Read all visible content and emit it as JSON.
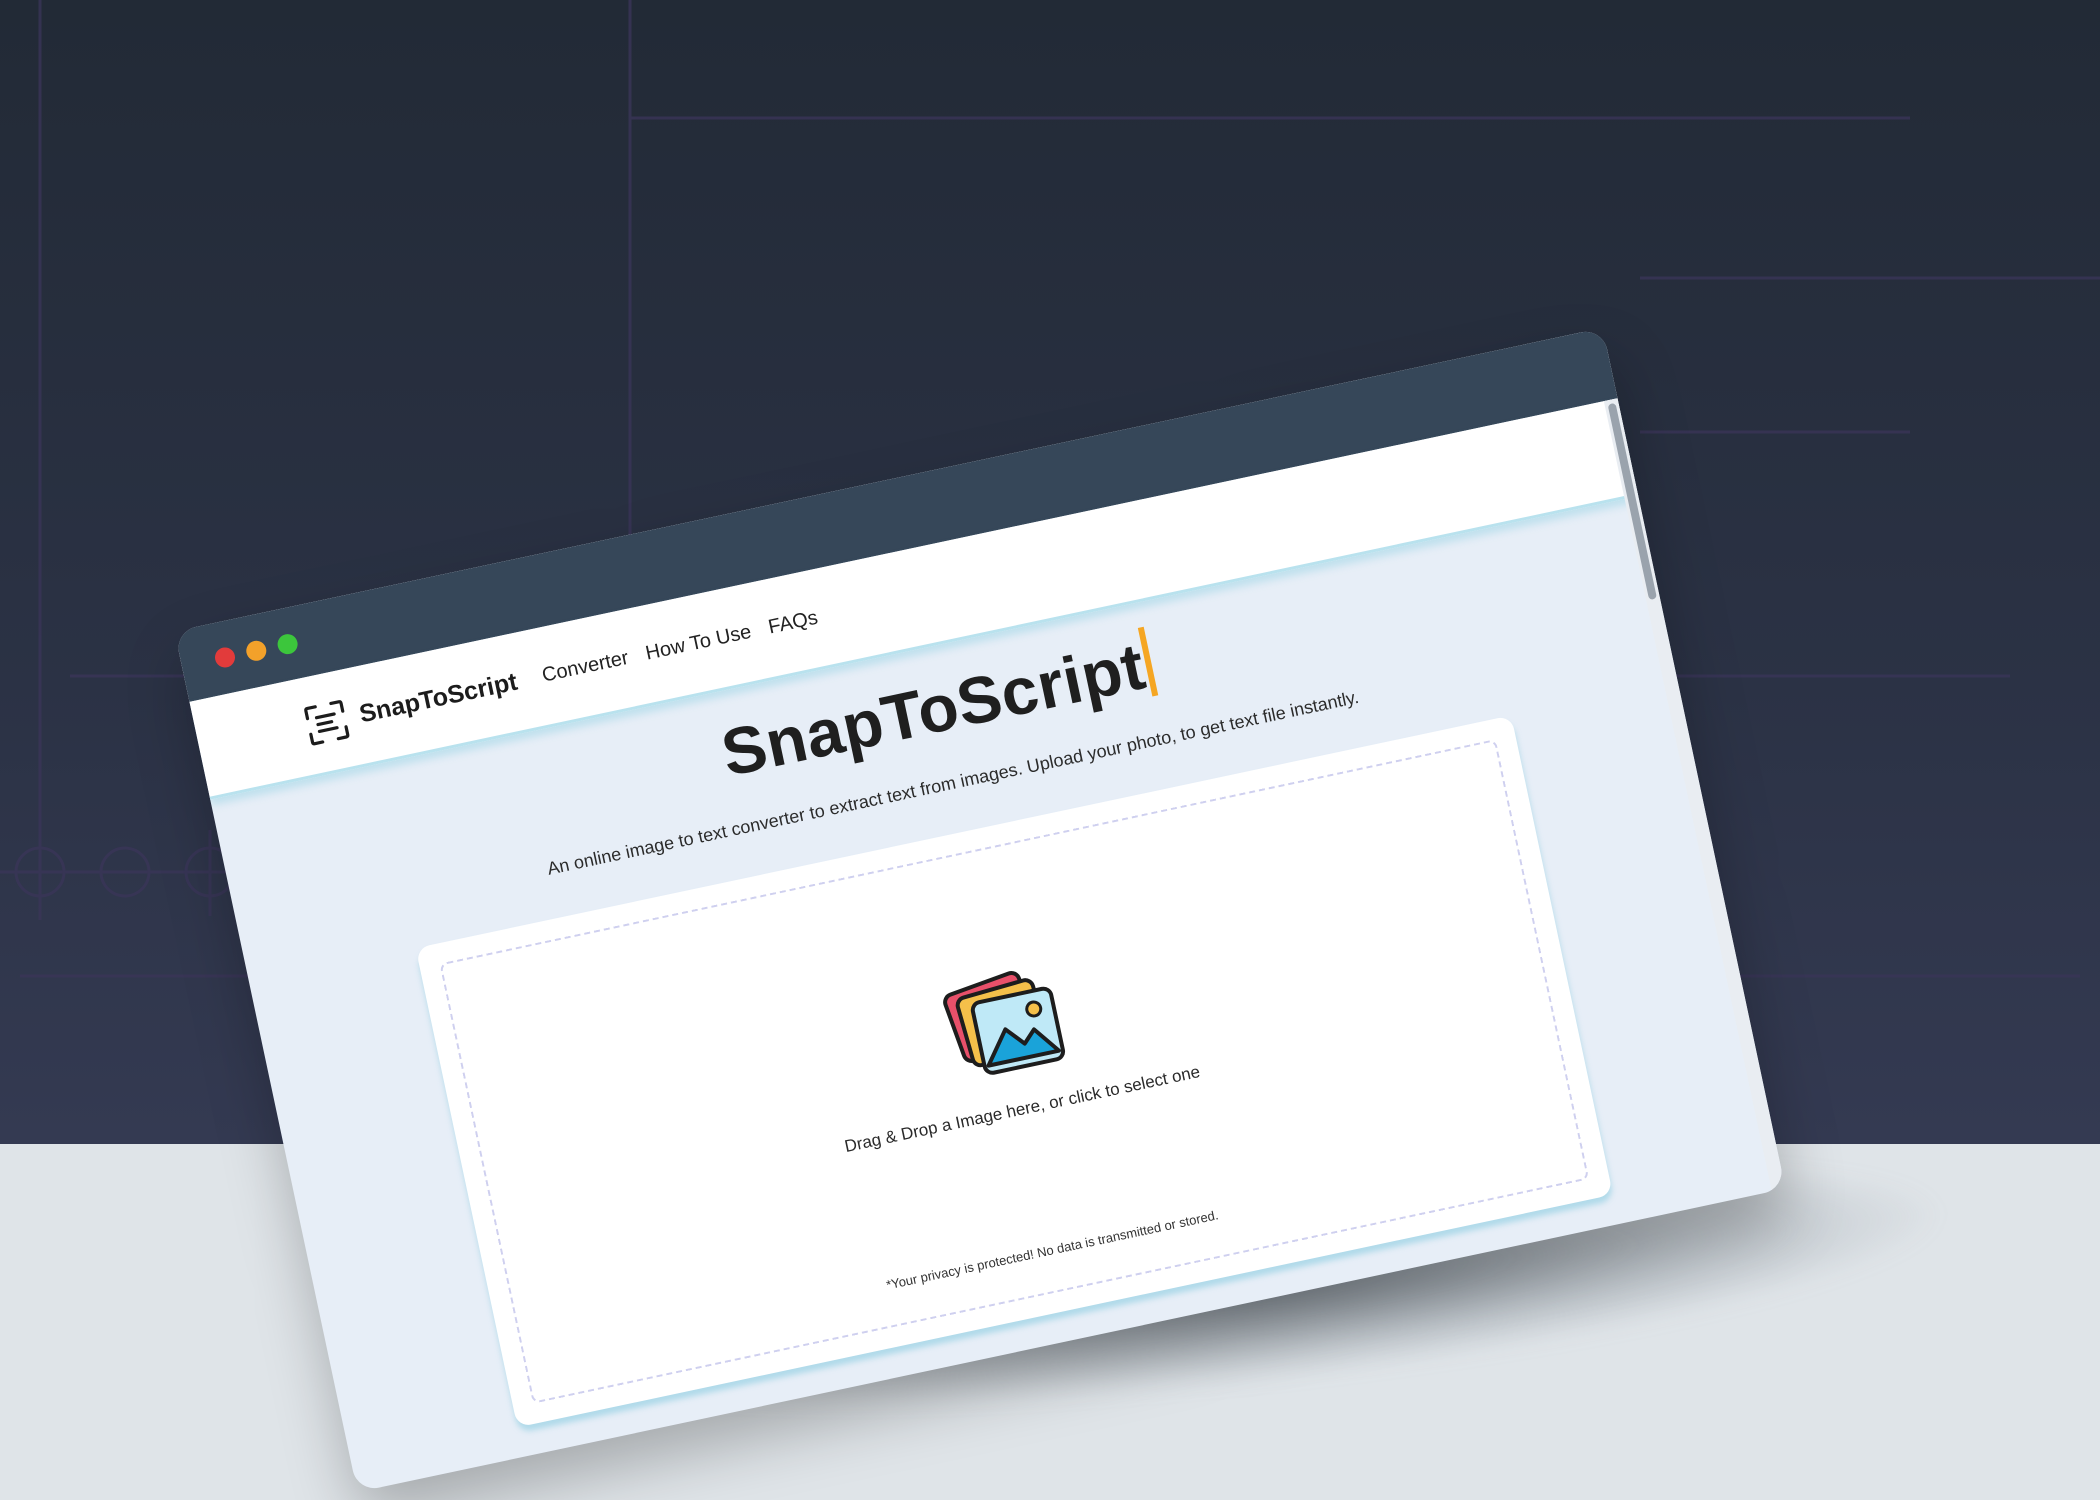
{
  "window": {
    "controls": [
      "close",
      "minimize",
      "maximize"
    ],
    "colors": {
      "close": "#e23b3b",
      "minimize": "#f3a12a",
      "maximize": "#3cc63c"
    }
  },
  "navbar": {
    "brand": "SnapToScript",
    "logo_icon": "text-scan-icon",
    "links": [
      "Converter",
      "How To Use",
      "FAQs"
    ]
  },
  "hero": {
    "title": "SnapToScript",
    "subtitle": "An online image to text converter to extract text from images. Upload your photo, to get text file instantly."
  },
  "upload": {
    "icon": "image-gallery-icon",
    "instruction": "Drag & Drop a Image here, or click to select one",
    "privacy_note": "*Your privacy is protected! No data is transmitted or stored."
  },
  "colors": {
    "accent_caret": "#f5a623",
    "title_bar": "#364759",
    "page_background": "#e7eef7",
    "dropzone_border": "#cfd0ef"
  }
}
